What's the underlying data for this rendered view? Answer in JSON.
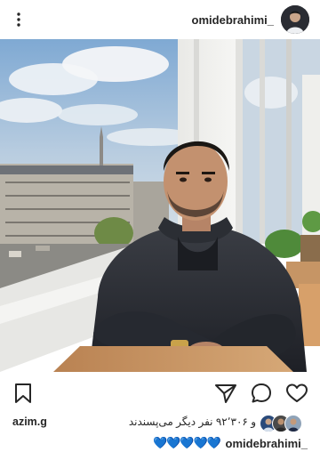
{
  "header": {
    "username": "omidebrahimi_"
  },
  "post": {
    "image_alt": "Man in a black jacket sitting by a window overlooking a city"
  },
  "likes": {
    "text": "و ۹۲٬۳۰۶ نفر دیگر می‌پسندند",
    "first_liker": "azim.g"
  },
  "caption": {
    "username": "omidebrahimi_",
    "text": "💙💙💙💙💙"
  },
  "icons": {
    "more": "more-vertical-icon",
    "save": "bookmark-icon",
    "share": "send-icon",
    "comment": "comment-icon",
    "like": "heart-icon"
  },
  "colors": {
    "text": "#262626",
    "heart_emoji": "#2aa7ee"
  }
}
